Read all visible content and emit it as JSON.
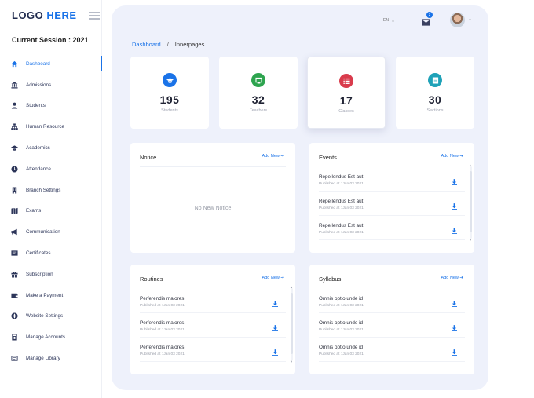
{
  "logo": {
    "part1": "LOGO",
    "part2": "HERE"
  },
  "session": "Current Session : 2021",
  "sidebar": {
    "items": [
      {
        "label": "Dashboard",
        "icon": "home-icon"
      },
      {
        "label": "Admissions",
        "icon": "bank-icon"
      },
      {
        "label": "Students",
        "icon": "student-icon"
      },
      {
        "label": "Human Resource",
        "icon": "sitemap-icon"
      },
      {
        "label": "Academics",
        "icon": "graduation-cap-icon"
      },
      {
        "label": "Attendance",
        "icon": "clock-icon"
      },
      {
        "label": "Branch Settings",
        "icon": "building-icon"
      },
      {
        "label": "Exams",
        "icon": "map-icon"
      },
      {
        "label": "Communication",
        "icon": "megaphone-icon"
      },
      {
        "label": "Certificates",
        "icon": "certificate-icon"
      },
      {
        "label": "Subscription",
        "icon": "gift-icon"
      },
      {
        "label": "Make a Payment",
        "icon": "wallet-icon"
      },
      {
        "label": "Website Settings",
        "icon": "globe-icon"
      },
      {
        "label": "Manage Accounts",
        "icon": "calculator-icon"
      },
      {
        "label": "Manage Library",
        "icon": "library-icon"
      }
    ],
    "active_index": 0
  },
  "topbar": {
    "language": "EN",
    "mail_badge": "2"
  },
  "breadcrumb": {
    "home": "Dashboard",
    "separator": "/",
    "current": "Innerpages"
  },
  "stats": [
    {
      "value": "195",
      "label": "Students",
      "color": "#1a73e8",
      "icon": "graduation-cap-icon"
    },
    {
      "value": "32",
      "label": "Teachers",
      "color": "#2ea44f",
      "icon": "chalkboard-icon"
    },
    {
      "value": "17",
      "label": "Classes",
      "color": "#d93b4c",
      "icon": "list-icon"
    },
    {
      "value": "30",
      "label": "Sections",
      "color": "#1fa2b8",
      "icon": "book-icon"
    }
  ],
  "notice": {
    "title": "Notice",
    "add": "Add New",
    "empty": "No New Notice"
  },
  "events": {
    "title": "Events",
    "add": "Add New",
    "items": [
      {
        "title": "Repellendus Est aut",
        "sub": "Published at : Jan 03 2021"
      },
      {
        "title": "Repellendus Est aut",
        "sub": "Published at : Jan 03 2021"
      },
      {
        "title": "Repellendus Est aut",
        "sub": "Published at : Jan 03 2021"
      }
    ]
  },
  "routines": {
    "title": "Routines",
    "add": "Add New",
    "items": [
      {
        "title": "Perferendis maiores",
        "sub": "Published at : Jan 03 2021"
      },
      {
        "title": "Perferendis maiores",
        "sub": "Published at : Jan 03 2021"
      },
      {
        "title": "Perferendis maiores",
        "sub": "Published at : Jan 03 2021"
      }
    ]
  },
  "syllabus": {
    "title": "Syllabus",
    "add": "Add New",
    "items": [
      {
        "title": "Omnis optio unde id",
        "sub": "Published at : Jan 03 2021"
      },
      {
        "title": "Omnis optio unde id",
        "sub": "Published at : Jan 03 2021"
      },
      {
        "title": "Omnis optio unde id",
        "sub": "Published at : Jan 03 2021"
      }
    ]
  },
  "arrow": "➔"
}
